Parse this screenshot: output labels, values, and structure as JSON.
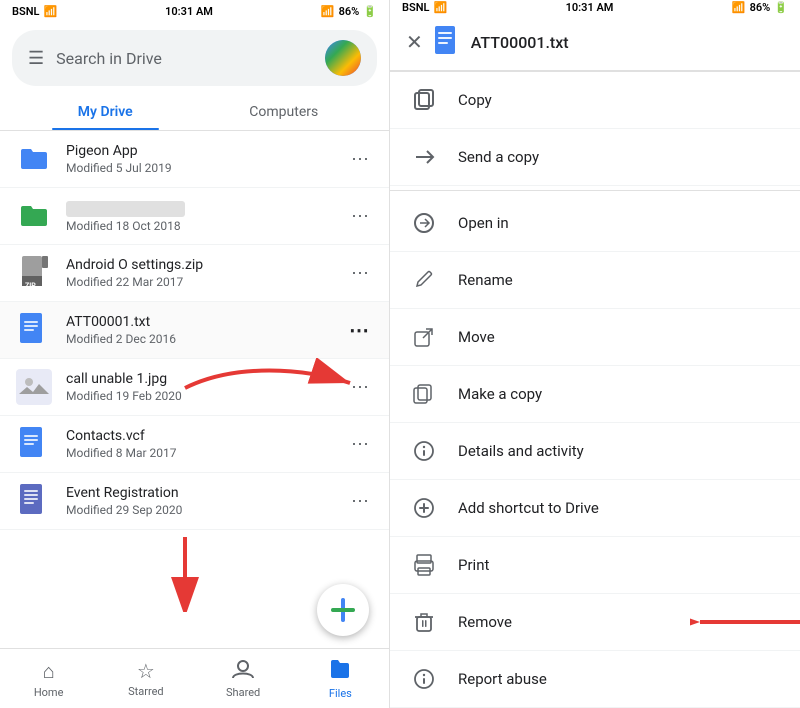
{
  "left": {
    "status_bar": {
      "carrier": "BSNL",
      "time": "10:31 AM",
      "battery": "86%"
    },
    "search_placeholder": "Search in Drive",
    "tabs": [
      {
        "id": "my-drive",
        "label": "My Drive",
        "active": true
      },
      {
        "id": "computers",
        "label": "Computers",
        "active": false
      }
    ],
    "files": [
      {
        "id": "pigeon-app",
        "name": "Pigeon App",
        "meta": "Modified 5 Jul 2019",
        "icon_type": "folder",
        "icon_color": "#4285f4"
      },
      {
        "id": "unknown-folder",
        "name": "",
        "meta": "Modified 18 Oct 2018",
        "icon_type": "folder",
        "icon_color": "#34a853"
      },
      {
        "id": "android-zip",
        "name": "Android O settings.zip",
        "meta": "Modified 22 Mar 2017",
        "icon_type": "zip",
        "icon_color": "#757575"
      },
      {
        "id": "att-file",
        "name": "ATT00001.txt",
        "meta": "Modified 2 Dec 2016",
        "icon_type": "doc",
        "icon_color": "#4285f4"
      },
      {
        "id": "call-unable",
        "name": "call unable 1.jpg",
        "meta": "Modified 19 Feb 2020",
        "icon_type": "image",
        "icon_color": "#757575"
      },
      {
        "id": "contacts",
        "name": "Contacts.vcf",
        "meta": "Modified 8 Mar 2017",
        "icon_type": "doc",
        "icon_color": "#4285f4"
      },
      {
        "id": "event-reg",
        "name": "Event Registration",
        "meta": "Modified 29 Sep 2020",
        "icon_type": "sheets",
        "icon_color": "#5c6bc0"
      }
    ],
    "bottom_nav": [
      {
        "id": "home",
        "label": "Home",
        "icon": "⌂",
        "active": false
      },
      {
        "id": "starred",
        "label": "Starred",
        "icon": "☆",
        "active": false
      },
      {
        "id": "shared",
        "label": "Shared",
        "icon": "👤",
        "active": false
      },
      {
        "id": "files",
        "label": "Files",
        "icon": "📁",
        "active": true
      }
    ]
  },
  "right": {
    "status_bar": {
      "carrier": "BSNL",
      "time": "10:31 AM",
      "battery": "86%"
    },
    "header": {
      "title": "ATT00001.txt",
      "close_label": "✕",
      "file_icon": "📄"
    },
    "menu_items": [
      {
        "id": "copy",
        "label": "Copy",
        "icon": "↗"
      },
      {
        "id": "send-copy",
        "label": "Send a copy",
        "icon": "↗"
      },
      {
        "id": "open-in",
        "label": "Open in",
        "icon": "⊕"
      },
      {
        "id": "rename",
        "label": "Rename",
        "icon": "✏"
      },
      {
        "id": "move",
        "label": "Move",
        "icon": "→□"
      },
      {
        "id": "make-copy",
        "label": "Make a copy",
        "icon": "⧉"
      },
      {
        "id": "details",
        "label": "Details and activity",
        "icon": "ℹ"
      },
      {
        "id": "add-shortcut",
        "label": "Add shortcut to Drive",
        "icon": "⊕"
      },
      {
        "id": "print",
        "label": "Print",
        "icon": "🖨"
      },
      {
        "id": "remove",
        "label": "Remove",
        "icon": "🗑"
      },
      {
        "id": "report-abuse",
        "label": "Report abuse",
        "icon": "ℹ"
      }
    ]
  }
}
